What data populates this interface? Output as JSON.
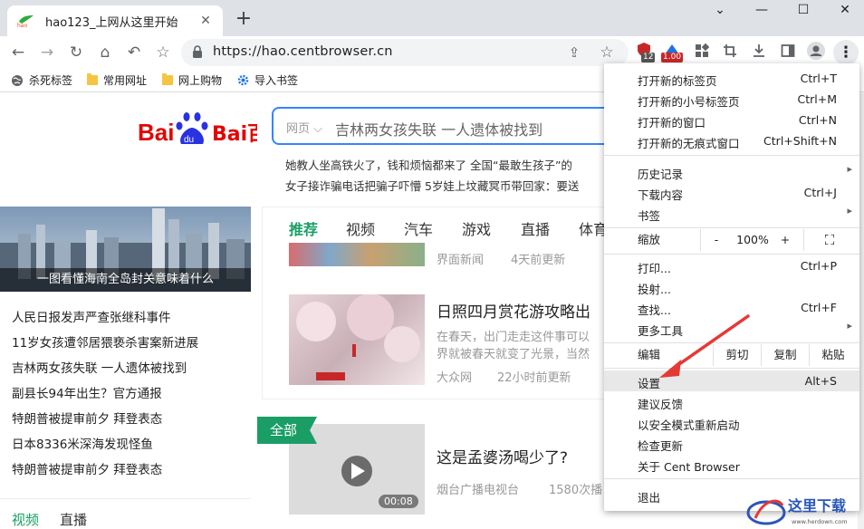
{
  "tab": {
    "title": "hao123_上网从这里开始",
    "close": "✕",
    "favicon_text": "hao"
  },
  "newtab": "+",
  "window": {
    "min": "⌄",
    "restore": "—",
    "max": "☐",
    "close": "✕"
  },
  "toolbar": {
    "back": "←",
    "forward": "→",
    "reload": "↻",
    "home": "⌂",
    "undo": "↶",
    "star": "☆",
    "url": "https://hao.centbrowser.cn",
    "share": "⇪",
    "bookmark_star": "☆",
    "ext1_badge": "12",
    "ext2_badge": "1.00",
    "menu": "⋮"
  },
  "bookmarks": [
    {
      "label": "杀死标签"
    },
    {
      "label": "常用网址"
    },
    {
      "label": "网上购物"
    },
    {
      "label": "导入书签"
    }
  ],
  "page": {
    "baidu_logo_text": "Bai百度",
    "search_category": "网页",
    "search_text": "吉林两女孩失联 一人遗体被找到",
    "hot_row1": "她教人坐高铁火了，钱和烦恼都来了     全国“最敢生孩子”的",
    "hot_row2": "女子接诈骗电话把骗子吓懵     5岁娃上坟藏冥币带回家：要送",
    "hero_caption": "一图看懂海南全岛封关意味着什么",
    "news": [
      "人民日报发声严查张继科事件",
      "11岁女孩遭邻居猥亵杀害案新进展",
      "吉林两女孩失联 一人遗体被找到",
      "副县长94年出生？官方通报",
      "特朗普被提审前夕 拜登表态",
      "日本8336米深海发现怪鱼",
      "特朗普被提审前夕 拜登表态"
    ],
    "left_tabs": [
      "视频",
      "直播"
    ],
    "feed_tabs": [
      "推荐",
      "视频",
      "汽车",
      "游戏",
      "直播",
      "体育"
    ],
    "article1_meta": [
      "界面新闻",
      "4天前更新"
    ],
    "article2_title": "日照四月赏花游攻略出",
    "article2_summary1": "在春天，出门走走这件事可以",
    "article2_summary2": "界就被春天就变了光景，当然",
    "article2_meta": [
      "大众网",
      "22小时前更新"
    ],
    "all_flag": "全部",
    "article3_title": "这是孟婆汤喝少了?",
    "article3_meta": [
      "烟台广播电视台",
      "1580次播"
    ],
    "video_duration": "00:08"
  },
  "menu": {
    "items1": [
      {
        "label": "打开新的标签页",
        "shortcut": "Ctrl+T"
      },
      {
        "label": "打开新的小号标签页",
        "shortcut": "Ctrl+M"
      },
      {
        "label": "打开新的窗口",
        "shortcut": "Ctrl+N"
      },
      {
        "label": "打开新的无痕式窗口",
        "shortcut": "Ctrl+Shift+N"
      }
    ],
    "items2": [
      {
        "label": "历史记录",
        "arrow": "▸"
      },
      {
        "label": "下载内容",
        "shortcut": "Ctrl+J"
      },
      {
        "label": "书签",
        "arrow": "▸"
      }
    ],
    "zoom": {
      "label": "缩放",
      "minus": "-",
      "value": "100%",
      "plus": "+",
      "fullscreen": "⛶"
    },
    "items3": [
      {
        "label": "打印...",
        "shortcut": "Ctrl+P"
      },
      {
        "label": "投射..."
      },
      {
        "label": "查找...",
        "shortcut": "Ctrl+F"
      },
      {
        "label": "更多工具",
        "arrow": "▸"
      }
    ],
    "edit": {
      "label": "编辑",
      "cut": "剪切",
      "copy": "复制",
      "paste": "粘贴"
    },
    "items4": [
      {
        "label": "设置",
        "shortcut": "Alt+S"
      },
      {
        "label": "建议反馈"
      },
      {
        "label": "以安全模式重新启动"
      },
      {
        "label": "检查更新"
      },
      {
        "label": "关于 Cent Browser"
      }
    ],
    "exit": "退出"
  },
  "watermark": {
    "text": "这里下载",
    "url": "www.herdown.com"
  },
  "colors": {
    "accent_red": "#e53935",
    "baidu_blue": "#2932e1",
    "baidu_red": "#e10602",
    "green": "#1a9e66"
  }
}
